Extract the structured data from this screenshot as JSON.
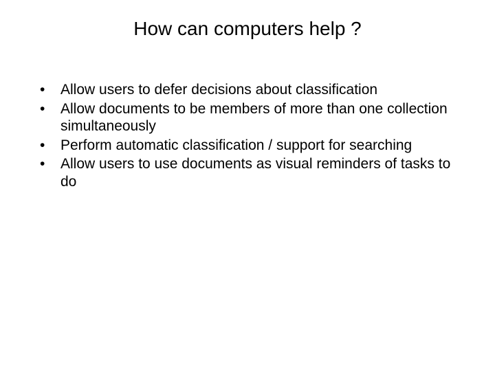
{
  "title": "How can computers help ?",
  "bullets": [
    "Allow users to defer decisions about classification",
    "Allow documents to be members of more than one collection simultaneously",
    "Perform automatic classification / support for searching",
    "Allow users to use documents as visual reminders of tasks to do"
  ]
}
